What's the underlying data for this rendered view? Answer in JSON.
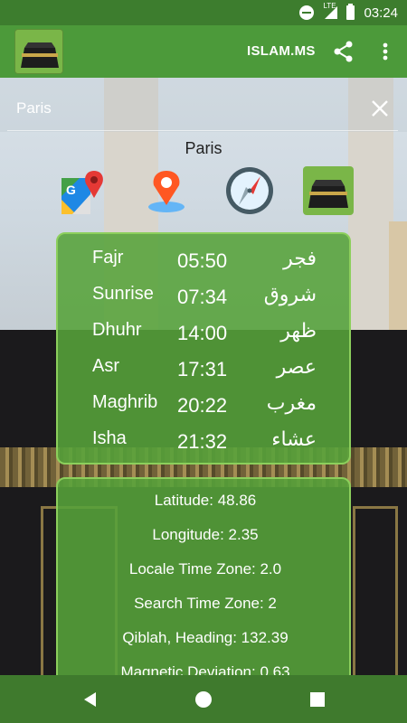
{
  "status_bar": {
    "time": "03:24",
    "network": "LTE"
  },
  "app_bar": {
    "title": "ISLAM.MS"
  },
  "search": {
    "value": "Paris",
    "placeholder": ""
  },
  "city": {
    "name": "Paris"
  },
  "actions": [
    {
      "icon": "google-maps-icon"
    },
    {
      "icon": "location-pin-icon"
    },
    {
      "icon": "compass-icon"
    },
    {
      "icon": "kaaba-icon"
    }
  ],
  "prayers": [
    {
      "name": "Fajr",
      "time": "05:50",
      "arabic": "فجر"
    },
    {
      "name": "Sunrise",
      "time": "07:34",
      "arabic": "شروق"
    },
    {
      "name": "Dhuhr",
      "time": "14:00",
      "arabic": "ظهر"
    },
    {
      "name": "Asr",
      "time": "17:31",
      "arabic": "عصر"
    },
    {
      "name": "Maghrib",
      "time": "20:22",
      "arabic": "مغرب"
    },
    {
      "name": "Isha",
      "time": "21:32",
      "arabic": "عشاء"
    }
  ],
  "info": [
    "Latitude: 48.86",
    "Longitude: 2.35",
    "Locale Time Zone: 2.0",
    "Search Time Zone: 2",
    "Qiblah, Heading: 132.39",
    "Magnetic Deviation: 0.63"
  ],
  "colors": {
    "primary": "#4c9a3a",
    "status_bar": "#3d7d2e",
    "card": "#56a33a"
  }
}
